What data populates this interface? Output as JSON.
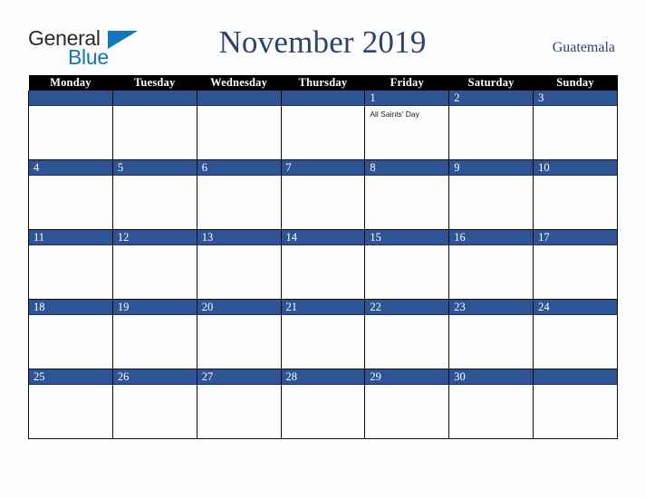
{
  "brand": {
    "name_part1": "General",
    "name_part2": "Blue",
    "triangle_icon": "triangle-icon",
    "color_dark": "#2b2b2b",
    "color_blue": "#1278be"
  },
  "header": {
    "title": "November 2019",
    "location": "Guatemala",
    "title_color": "#2e4369"
  },
  "calendar": {
    "weekday_headers": [
      "Monday",
      "Tuesday",
      "Wednesday",
      "Thursday",
      "Friday",
      "Saturday",
      "Sunday"
    ],
    "band_color": "#2f5496",
    "header_bg": "#000000",
    "weeks": [
      [
        {
          "day": "",
          "events": []
        },
        {
          "day": "",
          "events": []
        },
        {
          "day": "",
          "events": []
        },
        {
          "day": "",
          "events": []
        },
        {
          "day": "1",
          "events": [
            "All Saints’ Day"
          ]
        },
        {
          "day": "2",
          "events": []
        },
        {
          "day": "3",
          "events": []
        }
      ],
      [
        {
          "day": "4",
          "events": []
        },
        {
          "day": "5",
          "events": []
        },
        {
          "day": "6",
          "events": []
        },
        {
          "day": "7",
          "events": []
        },
        {
          "day": "8",
          "events": []
        },
        {
          "day": "9",
          "events": []
        },
        {
          "day": "10",
          "events": []
        }
      ],
      [
        {
          "day": "11",
          "events": []
        },
        {
          "day": "12",
          "events": []
        },
        {
          "day": "13",
          "events": []
        },
        {
          "day": "14",
          "events": []
        },
        {
          "day": "15",
          "events": []
        },
        {
          "day": "16",
          "events": []
        },
        {
          "day": "17",
          "events": []
        }
      ],
      [
        {
          "day": "18",
          "events": []
        },
        {
          "day": "19",
          "events": []
        },
        {
          "day": "20",
          "events": []
        },
        {
          "day": "21",
          "events": []
        },
        {
          "day": "22",
          "events": []
        },
        {
          "day": "23",
          "events": []
        },
        {
          "day": "24",
          "events": []
        }
      ],
      [
        {
          "day": "25",
          "events": []
        },
        {
          "day": "26",
          "events": []
        },
        {
          "day": "27",
          "events": []
        },
        {
          "day": "28",
          "events": []
        },
        {
          "day": "29",
          "events": []
        },
        {
          "day": "30",
          "events": []
        },
        {
          "day": "",
          "events": []
        }
      ]
    ]
  }
}
